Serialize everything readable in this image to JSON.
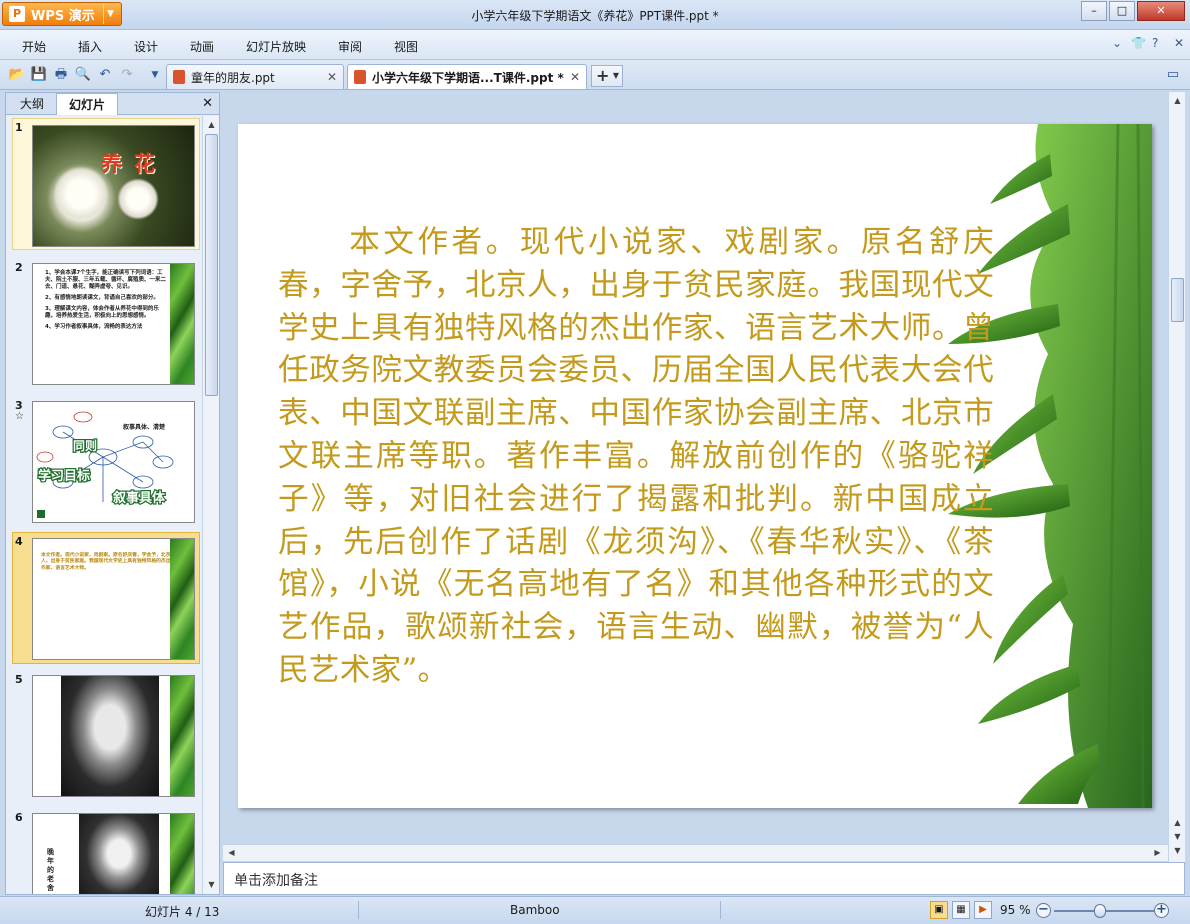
{
  "app": {
    "brand": "WPS 演示",
    "window_title": "小学六年级下学期语文《养花》PPT课件.ppt *"
  },
  "menu": {
    "items": [
      "开始",
      "插入",
      "设计",
      "动画",
      "幻灯片放映",
      "审阅",
      "视图"
    ]
  },
  "tabs": [
    {
      "label": "童年的朋友.ppt",
      "active": false
    },
    {
      "label": "小学六年级下学期语...T课件.ppt *",
      "active": true
    }
  ],
  "left_panel": {
    "tabs": [
      "大纲",
      "幻灯片"
    ],
    "active_tab": "幻灯片",
    "thumbnails": [
      {
        "number": "1",
        "title": "养花"
      },
      {
        "number": "2",
        "items": [
          "1、学会本课7个生字，能正确读写下列词语：工夫、院土不服、三年五载、循环、腐殖质、一来二去、门道、悬花、糊弄虚夸、见识。",
          "2、有感情地朗读课文，背诵自己喜欢的部分。",
          "3、理解课文内容，体会作者从养花中得到的乐趣，培养热爱生活，积极向上的思想感情。",
          "4、学习作者叙事具体，流畅的表达方法"
        ]
      },
      {
        "number": "3",
        "marker": "☆",
        "label": "叙事具体、清楚"
      },
      {
        "number": "4",
        "text": "本文作者。现代小说家、戏剧家。原名舒庆春，字舍予，北京人，出身于贫民家庭。我国现代文学史上具有独特风格的杰出作家、语言艺术大师。"
      },
      {
        "number": "5"
      },
      {
        "number": "6",
        "caption": "晚年的老舍"
      }
    ]
  },
  "slide": {
    "paragraph": "本文作者。现代小说家、戏剧家。原名舒庆春，字舍予，北京人，出身于贫民家庭。我国现代文学史上具有独特风格的杰出作家、语言艺术大师。曾任政务院文教委员会委员、历届全国人民代表大会代表、中国文联副主席、中国作家协会副主席、北京市文联主席等职。著作丰富。解放前创作的《骆驼祥子》等，对旧社会进行了揭露和批判。新中国成立后，先后创作了话剧《龙须沟》、《春华秋实》、《茶馆》，小说《无名高地有了名》和其他各种形式的文艺作品，歌颂新社会，语言生动、幽默，被誉为“人民艺术家”。",
    "text_color": "#c49a1c"
  },
  "notes_placeholder": "单击添加备注",
  "status": {
    "slide_counter": "幻灯片 4 / 13",
    "theme": "Bamboo",
    "zoom": "95 %"
  }
}
